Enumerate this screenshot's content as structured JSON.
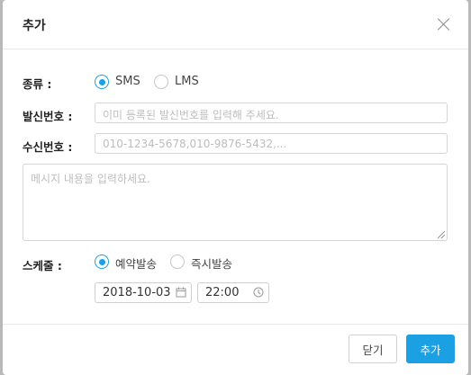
{
  "dialog": {
    "title": "추가",
    "close_icon": "close-icon"
  },
  "form": {
    "type": {
      "label": "종류 :",
      "options": [
        "SMS",
        "LMS"
      ],
      "selected": "SMS"
    },
    "sender": {
      "label": "발신번호 :",
      "placeholder": "이미 등록된 발신번호를 입력해 주세요.",
      "value": ""
    },
    "receiver": {
      "label": "수신번호 :",
      "placeholder": "010-1234-5678,010-9876-5432,...",
      "value": ""
    },
    "message": {
      "placeholder": "메시지 내용을 입력하세요.",
      "value": ""
    },
    "schedule": {
      "label": "스케줄 :",
      "options": [
        "예약발송",
        "즉시발송"
      ],
      "selected": "예약발송",
      "date": "2018-10-03",
      "time": "22:00",
      "date_icon": "calendar-icon",
      "time_icon": "clock-icon"
    }
  },
  "footer": {
    "close_label": "닫기",
    "add_label": "추가"
  },
  "colors": {
    "accent": "#1aa0e3",
    "backdrop": "#b9b9b9"
  }
}
